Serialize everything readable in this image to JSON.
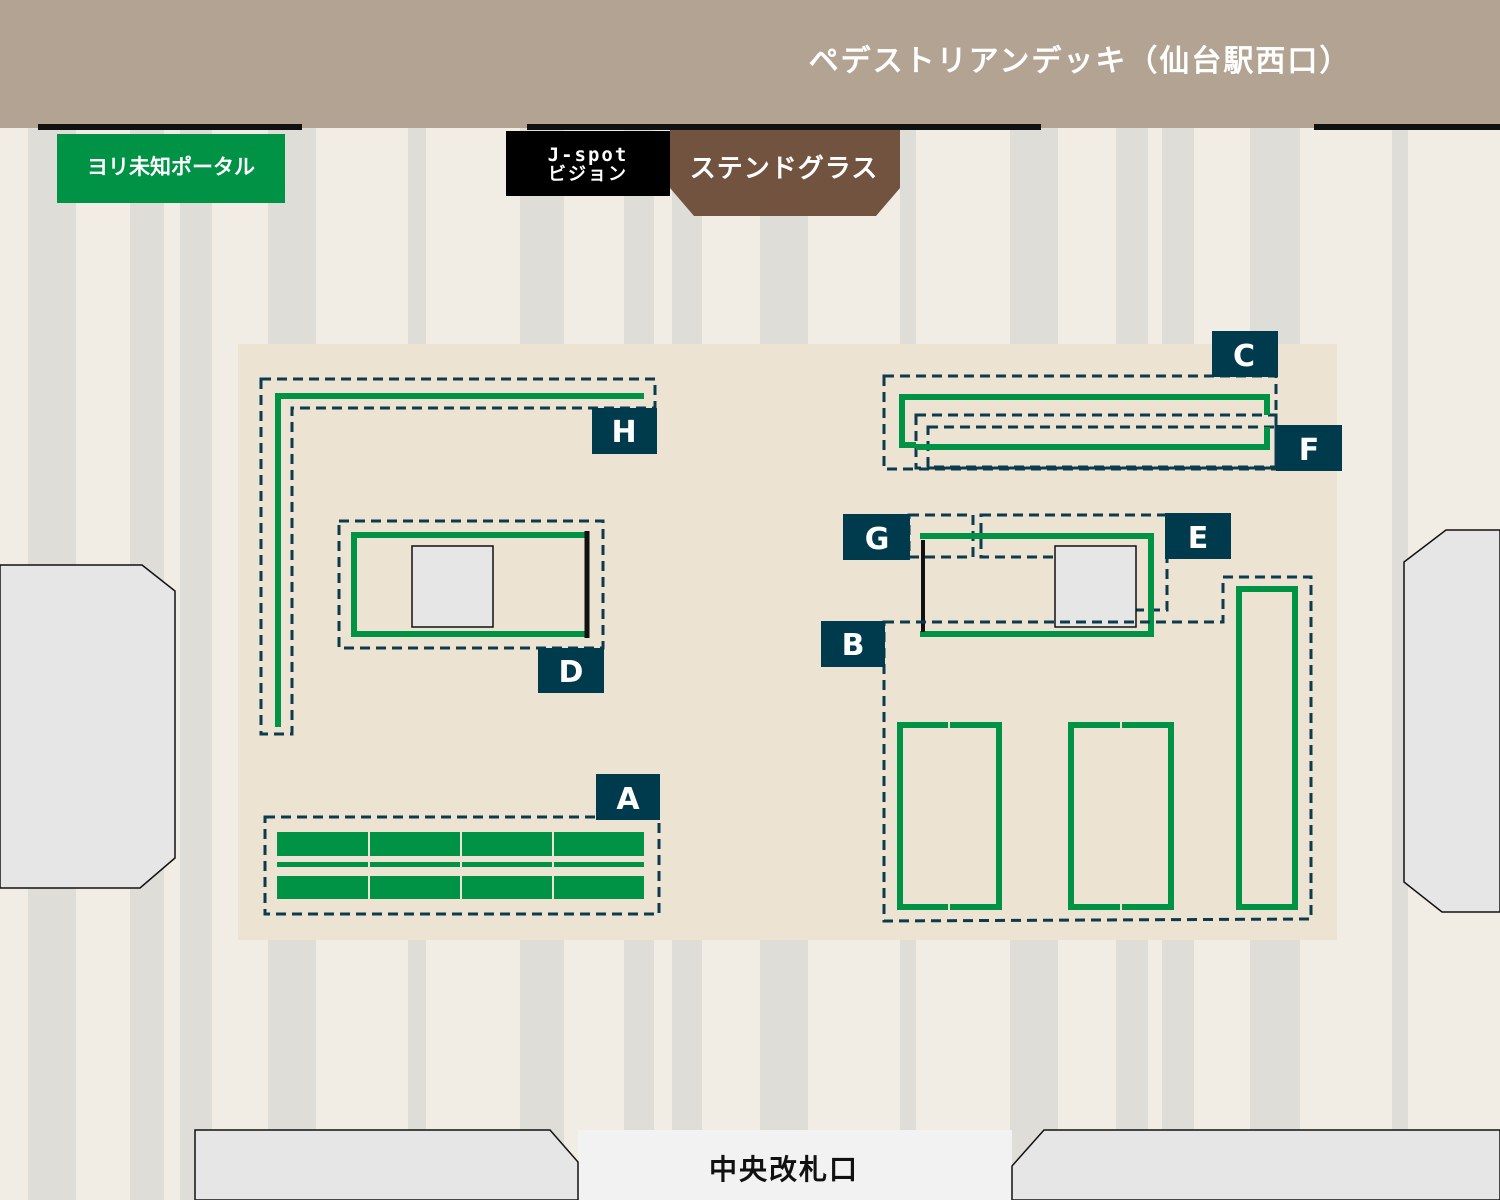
{
  "map": {
    "top_deck": {
      "label": "ペデストリアンデッキ（仙台駅西口）"
    },
    "landmarks": {
      "portal": {
        "label": "ヨリ未知ポータル"
      },
      "jspot": {
        "line1": "J-spot",
        "line2": "ビジョン"
      },
      "stained_glass": {
        "label": "ステンドグラス"
      },
      "gate": {
        "label": "中央改札口"
      }
    },
    "areas": [
      {
        "id": "A",
        "label": "A"
      },
      {
        "id": "B",
        "label": "B"
      },
      {
        "id": "C",
        "label": "C"
      },
      {
        "id": "D",
        "label": "D"
      },
      {
        "id": "E",
        "label": "E"
      },
      {
        "id": "F",
        "label": "F"
      },
      {
        "id": "G",
        "label": "G"
      },
      {
        "id": "H",
        "label": "H"
      }
    ],
    "colors": {
      "deck": "#b3a392",
      "floor_light": "#f4efe6",
      "floor_stripe": "#deddd7",
      "event_zone": "#ece3d2",
      "booth_green": "#009245",
      "area_label_bg": "#003b4d",
      "dashed_outline": "#0c3b4d",
      "portal_green": "#009245",
      "stained_glass_brown": "#725340",
      "jspot_black": "#000000",
      "pillar_gray": "#e6e6e6"
    }
  }
}
